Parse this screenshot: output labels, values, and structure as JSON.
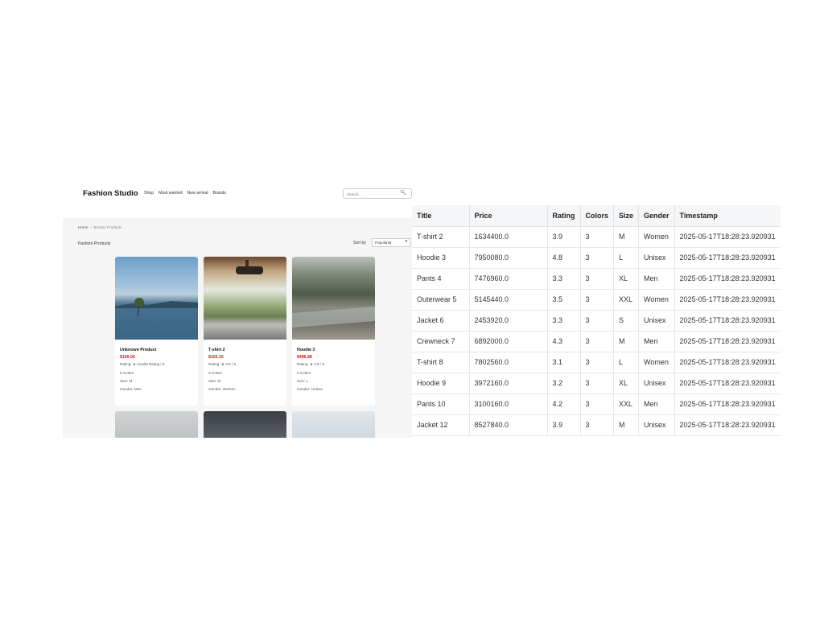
{
  "shop": {
    "brand": "Fashion Studio",
    "menu": [
      "Shop",
      "Most wanted",
      "New arrival",
      "Brands"
    ],
    "search_placeholder": "Search...",
    "breadcrumb": {
      "home": "Home",
      "separator": "/",
      "current": "Browse Products"
    },
    "section_title": "Fashion Products",
    "sort": {
      "label": "Sort by",
      "value": "Popularity"
    },
    "products": [
      {
        "name": "Unknown Product",
        "price": "$100.00",
        "rating": "Rating: ★ Invalid Rating / 5",
        "colors": "5 Colors",
        "size": "Size: M",
        "gender": "Gender: Men"
      },
      {
        "name": "T-shirt 2",
        "price": "$102.15",
        "rating": "Rating: ★ 3.9 / 5",
        "colors": "3 Colors",
        "size": "Size: M",
        "gender": "Gender: Women"
      },
      {
        "name": "Hoodie 3",
        "price": "$496.88",
        "rating": "Rating: ★ 4.8 / 5",
        "colors": "3 Colors",
        "size": "Size: L",
        "gender": "Gender: Unisex"
      }
    ]
  },
  "table": {
    "headers": [
      "Title",
      "Price",
      "Rating",
      "Colors",
      "Size",
      "Gender",
      "Timestamp"
    ],
    "rows": [
      [
        "T-shirt 2",
        "1634400.0",
        "3.9",
        "3",
        "M",
        "Women",
        "2025-05-17T18:28:23.920931"
      ],
      [
        "Hoodie 3",
        "7950080.0",
        "4.8",
        "3",
        "L",
        "Unisex",
        "2025-05-17T18:28:23.920931"
      ],
      [
        "Pants 4",
        "7476960.0",
        "3.3",
        "3",
        "XL",
        "Men",
        "2025-05-17T18:28:23.920931"
      ],
      [
        "Outerwear 5",
        "5145440.0",
        "3.5",
        "3",
        "XXL",
        "Women",
        "2025-05-17T18:28:23.920931"
      ],
      [
        "Jacket 6",
        "2453920.0",
        "3.3",
        "3",
        "S",
        "Unisex",
        "2025-05-17T18:28:23.920931"
      ],
      [
        "Crewneck 7",
        "6892000.0",
        "4.3",
        "3",
        "M",
        "Men",
        "2025-05-17T18:28:23.920931"
      ],
      [
        "T-shirt 8",
        "7802560.0",
        "3.1",
        "3",
        "L",
        "Women",
        "2025-05-17T18:28:23.920931"
      ],
      [
        "Hoodie 9",
        "3972160.0",
        "3.2",
        "3",
        "XL",
        "Unisex",
        "2025-05-17T18:28:23.920931"
      ],
      [
        "Pants 10",
        "3100160.0",
        "4.2",
        "3",
        "XXL",
        "Men",
        "2025-05-17T18:28:23.920931"
      ],
      [
        "Jacket 12",
        "8527840.0",
        "3.9",
        "3",
        "M",
        "Unisex",
        "2025-05-17T18:28:23.920931"
      ]
    ]
  }
}
